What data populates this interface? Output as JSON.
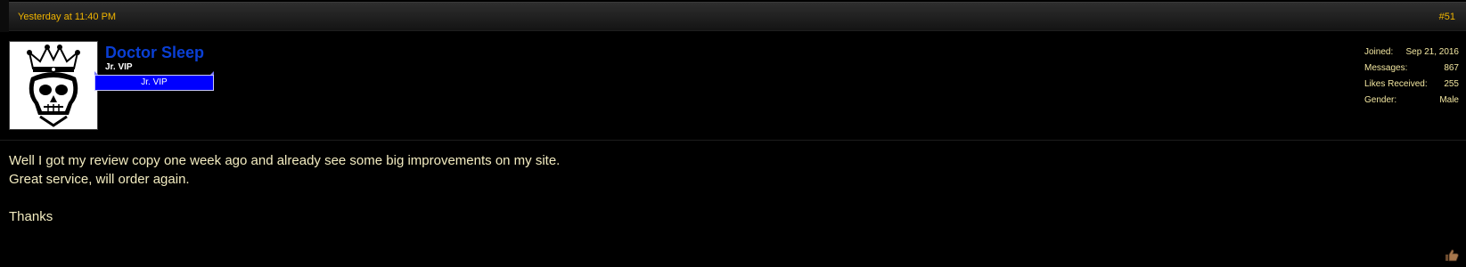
{
  "post": {
    "date": "Yesterday at 11:40 PM",
    "number": "#51",
    "author": {
      "name": "Doctor Sleep",
      "title": "Jr. VIP",
      "banner": "Jr. VIP",
      "avatar_icon": "skull-crown-icon"
    },
    "stats": [
      {
        "label": "Joined:",
        "value": "Sep 21, 2016"
      },
      {
        "label": "Messages:",
        "value": "867"
      },
      {
        "label": "Likes Received:",
        "value": "255"
      },
      {
        "label": "Gender:",
        "value": "Male"
      }
    ],
    "message": {
      "lines": [
        "Well I got my review copy one week ago and already see some big improvements on my site.",
        "Great service, will order again.",
        "Thanks"
      ]
    },
    "like_icon": "thumbs-up-icon"
  },
  "colors": {
    "background": "#000000",
    "date": "#f0b400",
    "username": "#0a3fd4",
    "banner": "#0000ff",
    "text": "#f3ecc0"
  }
}
